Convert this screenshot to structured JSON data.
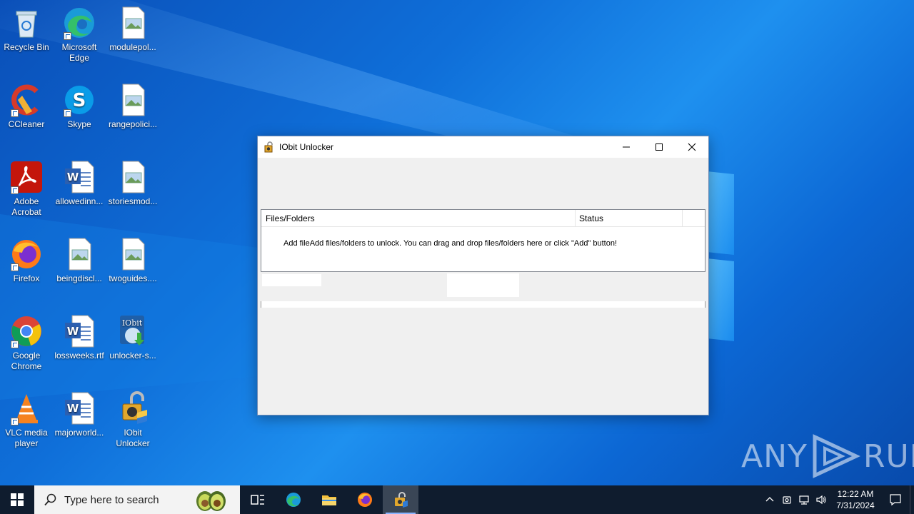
{
  "desktop": {
    "icons": [
      {
        "label": "Recycle Bin"
      },
      {
        "label": "Microsoft Edge"
      },
      {
        "label": "modulepol..."
      },
      {
        "label": "CCleaner"
      },
      {
        "label": "Skype"
      },
      {
        "label": "rangepolici..."
      },
      {
        "label": "Adobe Acrobat"
      },
      {
        "label": "allowedinn..."
      },
      {
        "label": "storiesmod..."
      },
      {
        "label": "Firefox"
      },
      {
        "label": "beingdiscl..."
      },
      {
        "label": "twoguides...."
      },
      {
        "label": "Google Chrome"
      },
      {
        "label": "lossweeks.rtf"
      },
      {
        "label": "unlocker-s..."
      },
      {
        "label": "VLC media player"
      },
      {
        "label": "majorworld..."
      },
      {
        "label": "IObit Unlocker"
      }
    ]
  },
  "window": {
    "title": "IObit Unlocker",
    "columns": {
      "files": "Files/Folders",
      "status": "Status"
    },
    "hint": "Add fileAdd files/folders to unlock. You can drag and drop files/folders here or click \"Add\" button!"
  },
  "taskbar": {
    "search_placeholder": "Type here to search",
    "time": "12:22 AM",
    "date": "7/31/2024"
  },
  "watermark": {
    "left": "ANY",
    "right": "RUN"
  }
}
